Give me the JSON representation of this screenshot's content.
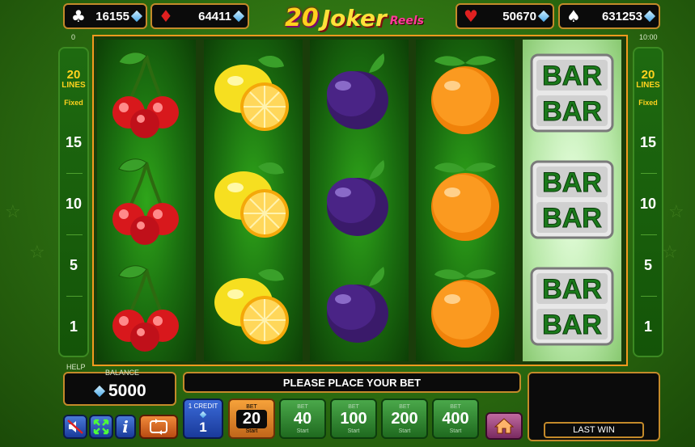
{
  "jackpots": [
    {
      "suit": "clubs",
      "symbol": "♣",
      "value": "16155",
      "color": "#ffffff"
    },
    {
      "suit": "diamonds",
      "symbol": "♦",
      "value": "64411",
      "color": "#e02020"
    },
    {
      "suit": "hearts",
      "symbol": "♥",
      "value": "50670",
      "color": "#e02020"
    },
    {
      "suit": "spades",
      "symbol": "♠",
      "value": "631253",
      "color": "#ffffff"
    }
  ],
  "logo": {
    "number": "20",
    "word": "Joker",
    "sub": "Reels"
  },
  "top_small": {
    "left": "0",
    "right": "10:00"
  },
  "lines_panel": {
    "count": "20",
    "label": "LINES",
    "fixed": "Fixed",
    "numbers": [
      "15",
      "10",
      "5",
      "1"
    ]
  },
  "reels": [
    [
      "cherry",
      "cherry",
      "cherry"
    ],
    [
      "lemon",
      "lemon",
      "lemon"
    ],
    [
      "plum",
      "plum",
      "plum"
    ],
    [
      "orange",
      "orange",
      "orange"
    ],
    [
      "bar",
      "bar",
      "bar"
    ]
  ],
  "bar_text": "BAR",
  "help_label": "HELP",
  "balance": {
    "label": "BALANCE",
    "value": "5000"
  },
  "message": "PLEASE PLACE YOUR BET",
  "credit": {
    "label": "1 CREDIT",
    "value": "1"
  },
  "bet_buttons": [
    {
      "top_label": "BET",
      "value": "20",
      "sub": "Start",
      "active": true
    },
    {
      "top_label": "BET",
      "value": "40",
      "sub": "Start",
      "active": false
    },
    {
      "top_label": "BET",
      "value": "100",
      "sub": "Start",
      "active": false
    },
    {
      "top_label": "BET",
      "value": "200",
      "sub": "Start",
      "active": false
    },
    {
      "top_label": "BET",
      "value": "400",
      "sub": "Start",
      "active": false
    }
  ],
  "last_win_label": "LAST WIN",
  "icons": [
    "sound-mute-icon",
    "fullscreen-icon",
    "info-icon",
    "autoplay-icon",
    "home-icon"
  ],
  "colors": {
    "frame": "#f29a1e",
    "gold": "#ffd21e",
    "panel": "#0b0b0b"
  }
}
